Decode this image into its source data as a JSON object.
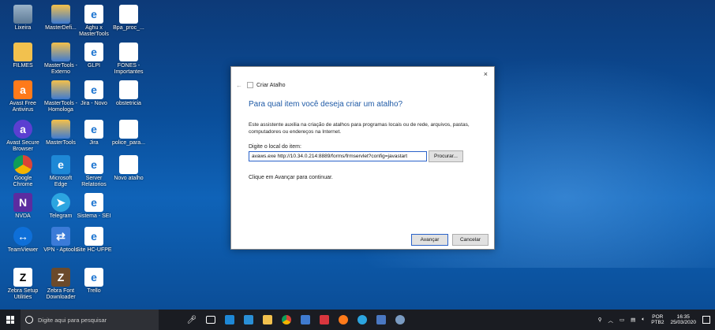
{
  "desktop_icons": [
    {
      "label": "Lixeira",
      "icon": "recycle-bin-icon"
    },
    {
      "label": "MasterDefi...",
      "icon": "mastertools-icon"
    },
    {
      "label": "Aghu x MasterTools",
      "icon": "edge-shortcut-icon"
    },
    {
      "label": "Bpa_proc_...",
      "icon": "document-icon"
    },
    {
      "label": "FILMES",
      "icon": "folder-icon"
    },
    {
      "label": "MasterTools - Externo",
      "icon": "mastertools-icon"
    },
    {
      "label": "GLPI",
      "icon": "edge-shortcut-icon"
    },
    {
      "label": "FONES - Importantes",
      "icon": "document-icon"
    },
    {
      "label": "Avast Free Antivirus",
      "icon": "avast-icon"
    },
    {
      "label": "MasterTools - Homologa",
      "icon": "mastertools-icon"
    },
    {
      "label": "Jira - Novo",
      "icon": "edge-shortcut-icon"
    },
    {
      "label": "obstetricia",
      "icon": "document-icon"
    },
    {
      "label": "Avast Secure Browser",
      "icon": "avast-browser-icon"
    },
    {
      "label": "MasterTools",
      "icon": "mastertools-icon"
    },
    {
      "label": "Jira",
      "icon": "edge-shortcut-icon"
    },
    {
      "label": "police_para...",
      "icon": "document-icon"
    },
    {
      "label": "Google Chrome",
      "icon": "chrome-icon"
    },
    {
      "label": "Microsoft Edge",
      "icon": "microsoft-edge-icon"
    },
    {
      "label": "Server Relatorios",
      "icon": "edge-shortcut-icon"
    },
    {
      "label": "Novo atalho",
      "icon": "document-icon"
    },
    {
      "label": "NVDA",
      "icon": "nvda-icon"
    },
    {
      "label": "Telegram",
      "icon": "telegram-icon"
    },
    {
      "label": "Sistema - SEI",
      "icon": "edge-shortcut-icon"
    },
    {
      "label": "TeamViewer",
      "icon": "teamviewer-icon"
    },
    {
      "label": "VPN - Aptools",
      "icon": "vpn-icon"
    },
    {
      "label": "Site HC-UFPE",
      "icon": "edge-shortcut-icon"
    },
    {
      "label": "Zebra Setup Utilities",
      "icon": "zebra-setup-icon"
    },
    {
      "label": "Zebra Font Downloader",
      "icon": "zebra-font-icon"
    },
    {
      "label": "Trello",
      "icon": "edge-shortcut-icon"
    }
  ],
  "dialog": {
    "window_title": "Criar Atalho",
    "heading": "Para qual item você deseja criar um atalho?",
    "description": "Este assistente auxilia na criação de atalhos para programas locais ou de rede, arquivos, pastas, computadores ou endereços na Internet.",
    "field_label": "Digite o local do item:",
    "field_value": "avaws.exe http://10.34.0.214:8889/forms/frmservlet?config=javastart",
    "browse_label": "Procurar...",
    "hint": "Clique em Avançar para continuar.",
    "next_label": "Avançar",
    "cancel_label": "Cancelar",
    "close_glyph": "×",
    "back_glyph": "←"
  },
  "taskbar": {
    "search_placeholder": "Digite aqui para pesquisar",
    "apps": [
      "microphone-icon",
      "task-view-icon",
      "edge-icon",
      "store-icon",
      "file-explorer-icon",
      "chrome-icon",
      "mastertools-icon",
      "photos-icon",
      "avast-icon",
      "telegram-icon",
      "calculator-icon",
      "settings-icon"
    ],
    "language_line1": "POR",
    "language_line2": "PTB2",
    "time": "16:35",
    "date": "25/03/2020"
  }
}
